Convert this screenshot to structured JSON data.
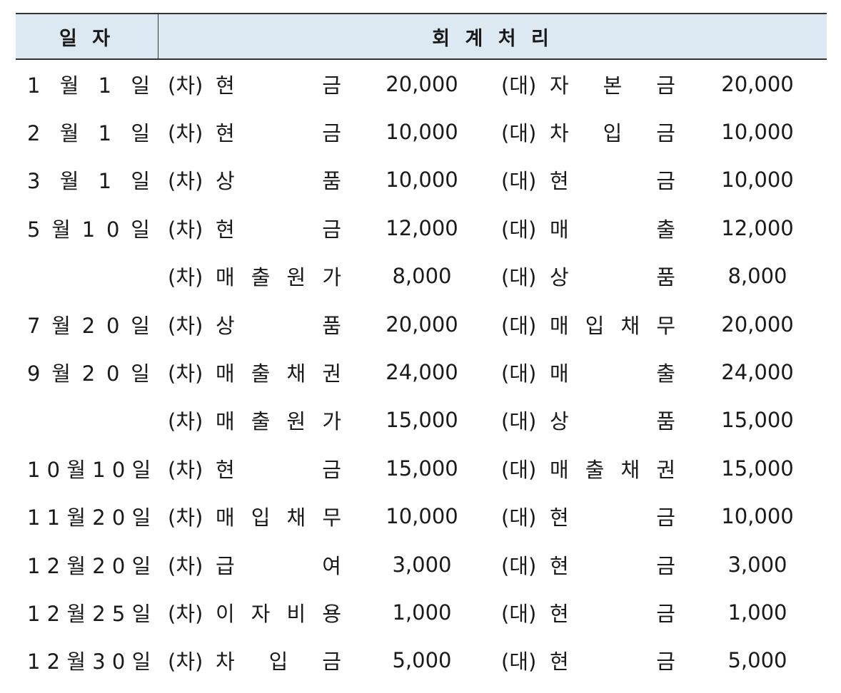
{
  "header": {
    "date_label": "일 자",
    "entry_label": "회 계 처 리"
  },
  "entries": [
    {
      "date": "1 월 1 일",
      "debit_mark": "(차)",
      "debit_account": "현 금",
      "debit_amount": "20,000",
      "credit_mark": "(대)",
      "credit_account": "자 본 금",
      "credit_amount": "20,000"
    },
    {
      "date": "2 월 1 일",
      "debit_mark": "(차)",
      "debit_account": "현 금",
      "debit_amount": "10,000",
      "credit_mark": "(대)",
      "credit_account": "차 입 금",
      "credit_amount": "10,000"
    },
    {
      "date": "3 월 1 일",
      "debit_mark": "(차)",
      "debit_account": "상 품",
      "debit_amount": "10,000",
      "credit_mark": "(대)",
      "credit_account": "현 금",
      "credit_amount": "10,000"
    },
    {
      "date": "5 월 1 0 일",
      "debit_mark": "(차)",
      "debit_account": "현 금",
      "debit_amount": "12,000",
      "credit_mark": "(대)",
      "credit_account": "매 출",
      "credit_amount": "12,000"
    },
    {
      "date": "",
      "debit_mark": "(차)",
      "debit_account": "매 출 원 가",
      "debit_amount": "8,000",
      "credit_mark": "(대)",
      "credit_account": "상 품",
      "credit_amount": "8,000"
    },
    {
      "date": "7 월 2 0 일",
      "debit_mark": "(차)",
      "debit_account": "상 품",
      "debit_amount": "20,000",
      "credit_mark": "(대)",
      "credit_account": "매 입 채 무",
      "credit_amount": "20,000"
    },
    {
      "date": "9 월 2 0 일",
      "debit_mark": "(차)",
      "debit_account": "매 출 채 권",
      "debit_amount": "24,000",
      "credit_mark": "(대)",
      "credit_account": "매 출",
      "credit_amount": "24,000"
    },
    {
      "date": "",
      "debit_mark": "(차)",
      "debit_account": "매 출 원 가",
      "debit_amount": "15,000",
      "credit_mark": "(대)",
      "credit_account": "상 품",
      "credit_amount": "15,000"
    },
    {
      "date": "1 0 월 1 0 일",
      "debit_mark": "(차)",
      "debit_account": "현 금",
      "debit_amount": "15,000",
      "credit_mark": "(대)",
      "credit_account": "매 출 채 권",
      "credit_amount": "15,000"
    },
    {
      "date": "1 1 월 2 0 일",
      "debit_mark": "(차)",
      "debit_account": "매 입 채 무",
      "debit_amount": "10,000",
      "credit_mark": "(대)",
      "credit_account": "현 금",
      "credit_amount": "10,000"
    },
    {
      "date": "1 2 월 2 0 일",
      "debit_mark": "(차)",
      "debit_account": "급 여",
      "debit_amount": "3,000",
      "credit_mark": "(대)",
      "credit_account": "현 금",
      "credit_amount": "3,000"
    },
    {
      "date": "1 2 월 2 5 일",
      "debit_mark": "(차)",
      "debit_account": "이 자 비 용",
      "debit_amount": "1,000",
      "credit_mark": "(대)",
      "credit_account": "현 금",
      "credit_amount": "1,000"
    },
    {
      "date": "1 2 월 3 0 일",
      "debit_mark": "(차)",
      "debit_account": "차 입 금",
      "debit_amount": "5,000",
      "credit_mark": "(대)",
      "credit_account": "현 금",
      "credit_amount": "5,000"
    }
  ]
}
